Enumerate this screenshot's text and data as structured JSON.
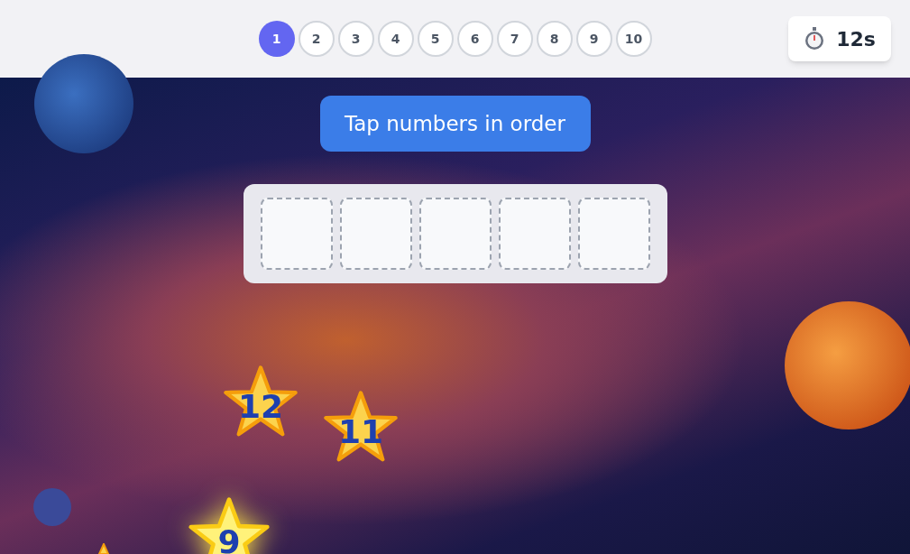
{
  "levels": [
    {
      "label": "1",
      "selected": true
    },
    {
      "label": "2",
      "selected": false
    },
    {
      "label": "3",
      "selected": false
    },
    {
      "label": "4",
      "selected": false
    },
    {
      "label": "5",
      "selected": false
    },
    {
      "label": "6",
      "selected": false
    },
    {
      "label": "7",
      "selected": false
    },
    {
      "label": "8",
      "selected": false
    },
    {
      "label": "9",
      "selected": false
    },
    {
      "label": "10",
      "selected": false
    }
  ],
  "timer": "12s",
  "instruction": "Tap numbers in order",
  "slots": [
    {
      "filled": false
    },
    {
      "filled": false
    },
    {
      "filled": false
    },
    {
      "filled": false
    },
    {
      "filled": false
    }
  ],
  "stars": [
    {
      "label": "12",
      "glowing": false
    },
    {
      "label": "11",
      "glowing": false
    },
    {
      "label": "9",
      "glowing": true
    }
  ]
}
